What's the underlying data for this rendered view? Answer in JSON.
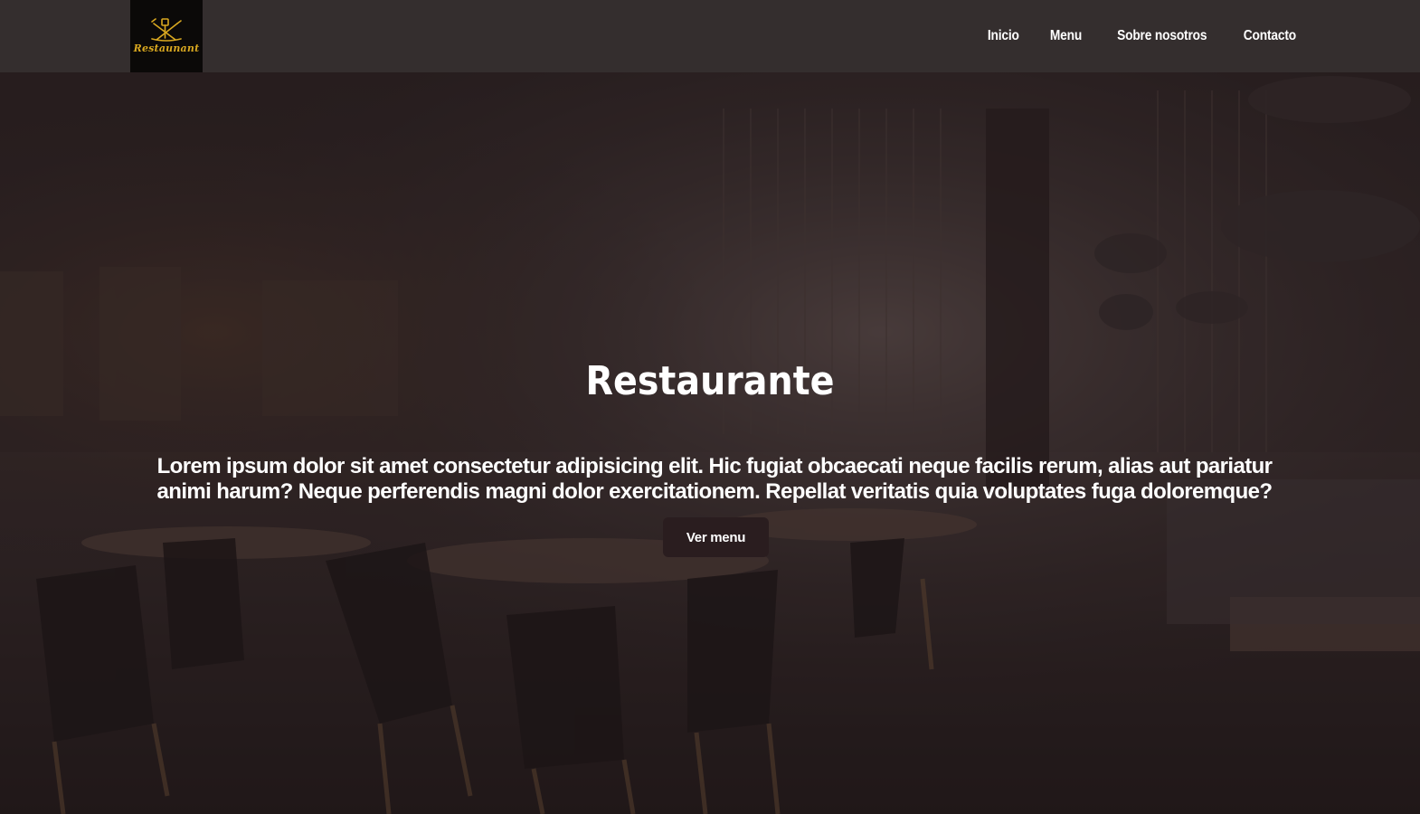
{
  "brand": {
    "logo_text": "Restaunant"
  },
  "nav": {
    "items": [
      {
        "label": "Inicio"
      },
      {
        "label": "Menu"
      },
      {
        "label": "Sobre nosotros"
      },
      {
        "label": "Contacto"
      }
    ]
  },
  "hero": {
    "title": "Restaurante",
    "description": "Lorem ipsum dolor sit amet consectetur adipisicing elit. Hic fugiat obcaecati neque facilis rerum, alias aut pariatur animi harum? Neque perferendis magni dolor exercitationem. Repellat veritatis quia voluptates fuga doloremque?",
    "button_label": "Ver menu"
  },
  "colors": {
    "navbar": "#342e2e",
    "logo_bg": "#0b0908",
    "logo_gold": "#d9a820",
    "button": "#2a1d1f"
  }
}
